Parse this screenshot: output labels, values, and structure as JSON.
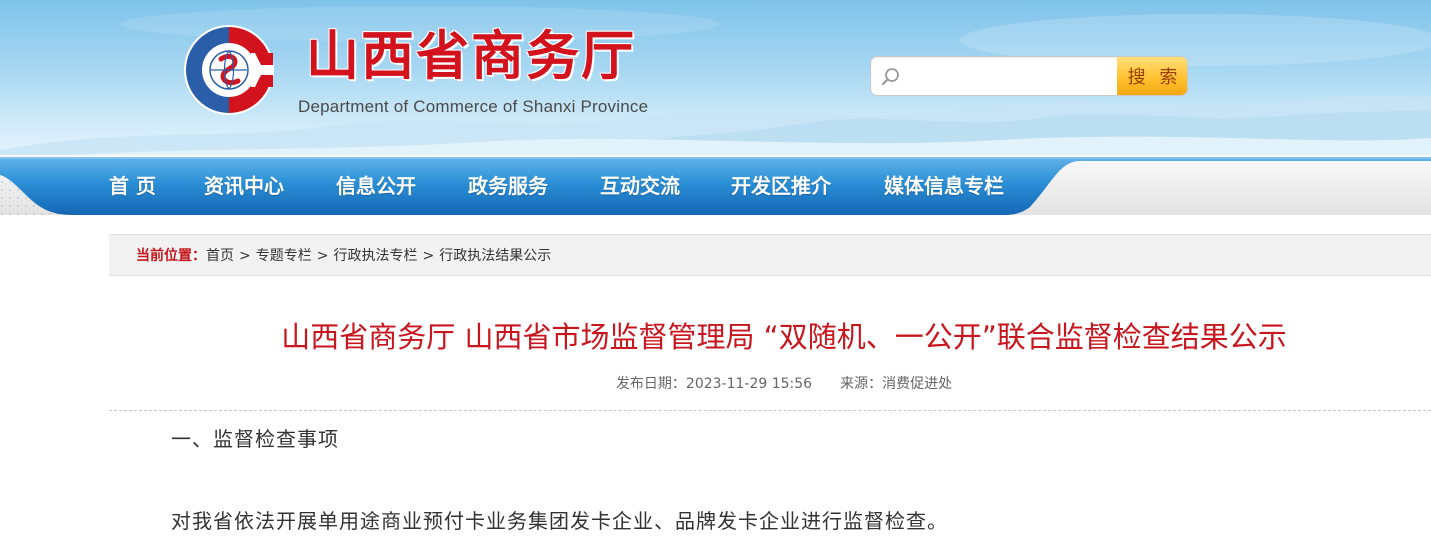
{
  "header": {
    "site_title": "山西省商务厅",
    "site_subtitle": "Department of Commerce of Shanxi Province",
    "search": {
      "placeholder": "",
      "button_label": "搜 索"
    },
    "colors": {
      "brand_red": "#d2121c",
      "brand_blue": "#2a5ea8",
      "nav_blue": "#1f7ec9"
    }
  },
  "nav": {
    "items": [
      {
        "label": "首  页"
      },
      {
        "label": "资讯中心"
      },
      {
        "label": "信息公开"
      },
      {
        "label": "政务服务"
      },
      {
        "label": "互动交流"
      },
      {
        "label": "开发区推介"
      },
      {
        "label": "媒体信息专栏"
      }
    ]
  },
  "breadcrumb": {
    "label": "当前位置：",
    "items": [
      {
        "label": "首页"
      },
      {
        "label": "专题专栏"
      },
      {
        "label": "行政执法专栏"
      },
      {
        "label": "行政执法结果公示"
      }
    ],
    "separator": ">"
  },
  "article": {
    "title": "山西省商务厅 山西省市场监督管理局 “双随机、一公开”联合监督检查结果公示",
    "meta": {
      "date": "发布日期：2023-11-29 15:56",
      "source": "来源：消费促进处"
    },
    "paragraphs": [
      "一、监督检查事项",
      "对我省依法开展单用途商业预付卡业务集团发卡企业、品牌发卡企业进行监督检查。"
    ]
  }
}
